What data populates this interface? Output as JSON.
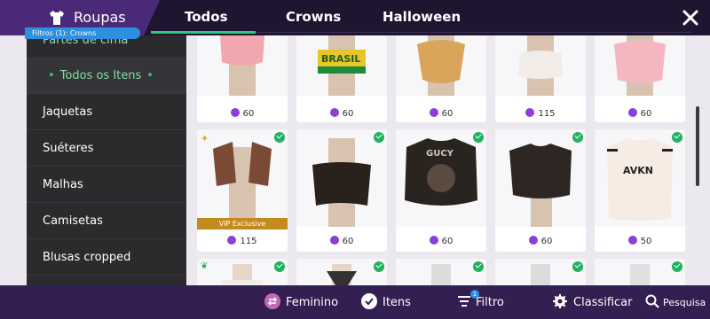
{
  "header": {
    "category_title": "Roupas",
    "tabs": [
      {
        "label": "Todos"
      },
      {
        "label": "Crowns"
      },
      {
        "label": "Halloween"
      }
    ],
    "filter_pill": "Filtros (1): Crowns"
  },
  "sidebar": {
    "items": [
      {
        "label": "Partes de cima"
      },
      {
        "label": "Todos os Itens"
      },
      {
        "label": "Jaquetas"
      },
      {
        "label": "Suéteres"
      },
      {
        "label": "Malhas"
      },
      {
        "label": "Camisetas"
      },
      {
        "label": "Blusas cropped"
      }
    ]
  },
  "grid": {
    "rows": [
      {
        "cards": [
          {
            "image_text": "",
            "price": "60",
            "owned": false
          },
          {
            "image_text": "BRASIL",
            "price": "60",
            "owned": false
          },
          {
            "image_text": "",
            "price": "60",
            "owned": false
          },
          {
            "image_text": "",
            "price": "115",
            "owned": false
          },
          {
            "image_text": "",
            "price": "60",
            "owned": false
          }
        ]
      },
      {
        "cards": [
          {
            "image_text": "",
            "price": "115",
            "owned": true,
            "vip_label": "VIP Exclusive"
          },
          {
            "image_text": "",
            "price": "60",
            "owned": true
          },
          {
            "image_text": "GUCY",
            "price": "60",
            "owned": true
          },
          {
            "image_text": "",
            "price": "60",
            "owned": true
          },
          {
            "image_text": "AVKN",
            "price": "50",
            "owned": true
          }
        ]
      },
      {
        "cards": [
          {
            "image_text": "",
            "owned": true
          },
          {
            "image_text": "",
            "owned": true
          },
          {
            "image_text": "",
            "owned": true
          },
          {
            "image_text": "",
            "owned": true
          },
          {
            "image_text": "",
            "owned": true
          }
        ]
      }
    ]
  },
  "bottom_bar": {
    "gender_label": "Feminino",
    "items_label": "Itens",
    "filter_label": "Filtro",
    "filter_count": "1",
    "sort_label": "Classificar",
    "search_label": "Pesquisa"
  },
  "colors": {
    "accent": "#2ec97a",
    "header_bg": "#1e1530",
    "bottom_bg": "#341f52",
    "coin": "#8b3fd6"
  }
}
